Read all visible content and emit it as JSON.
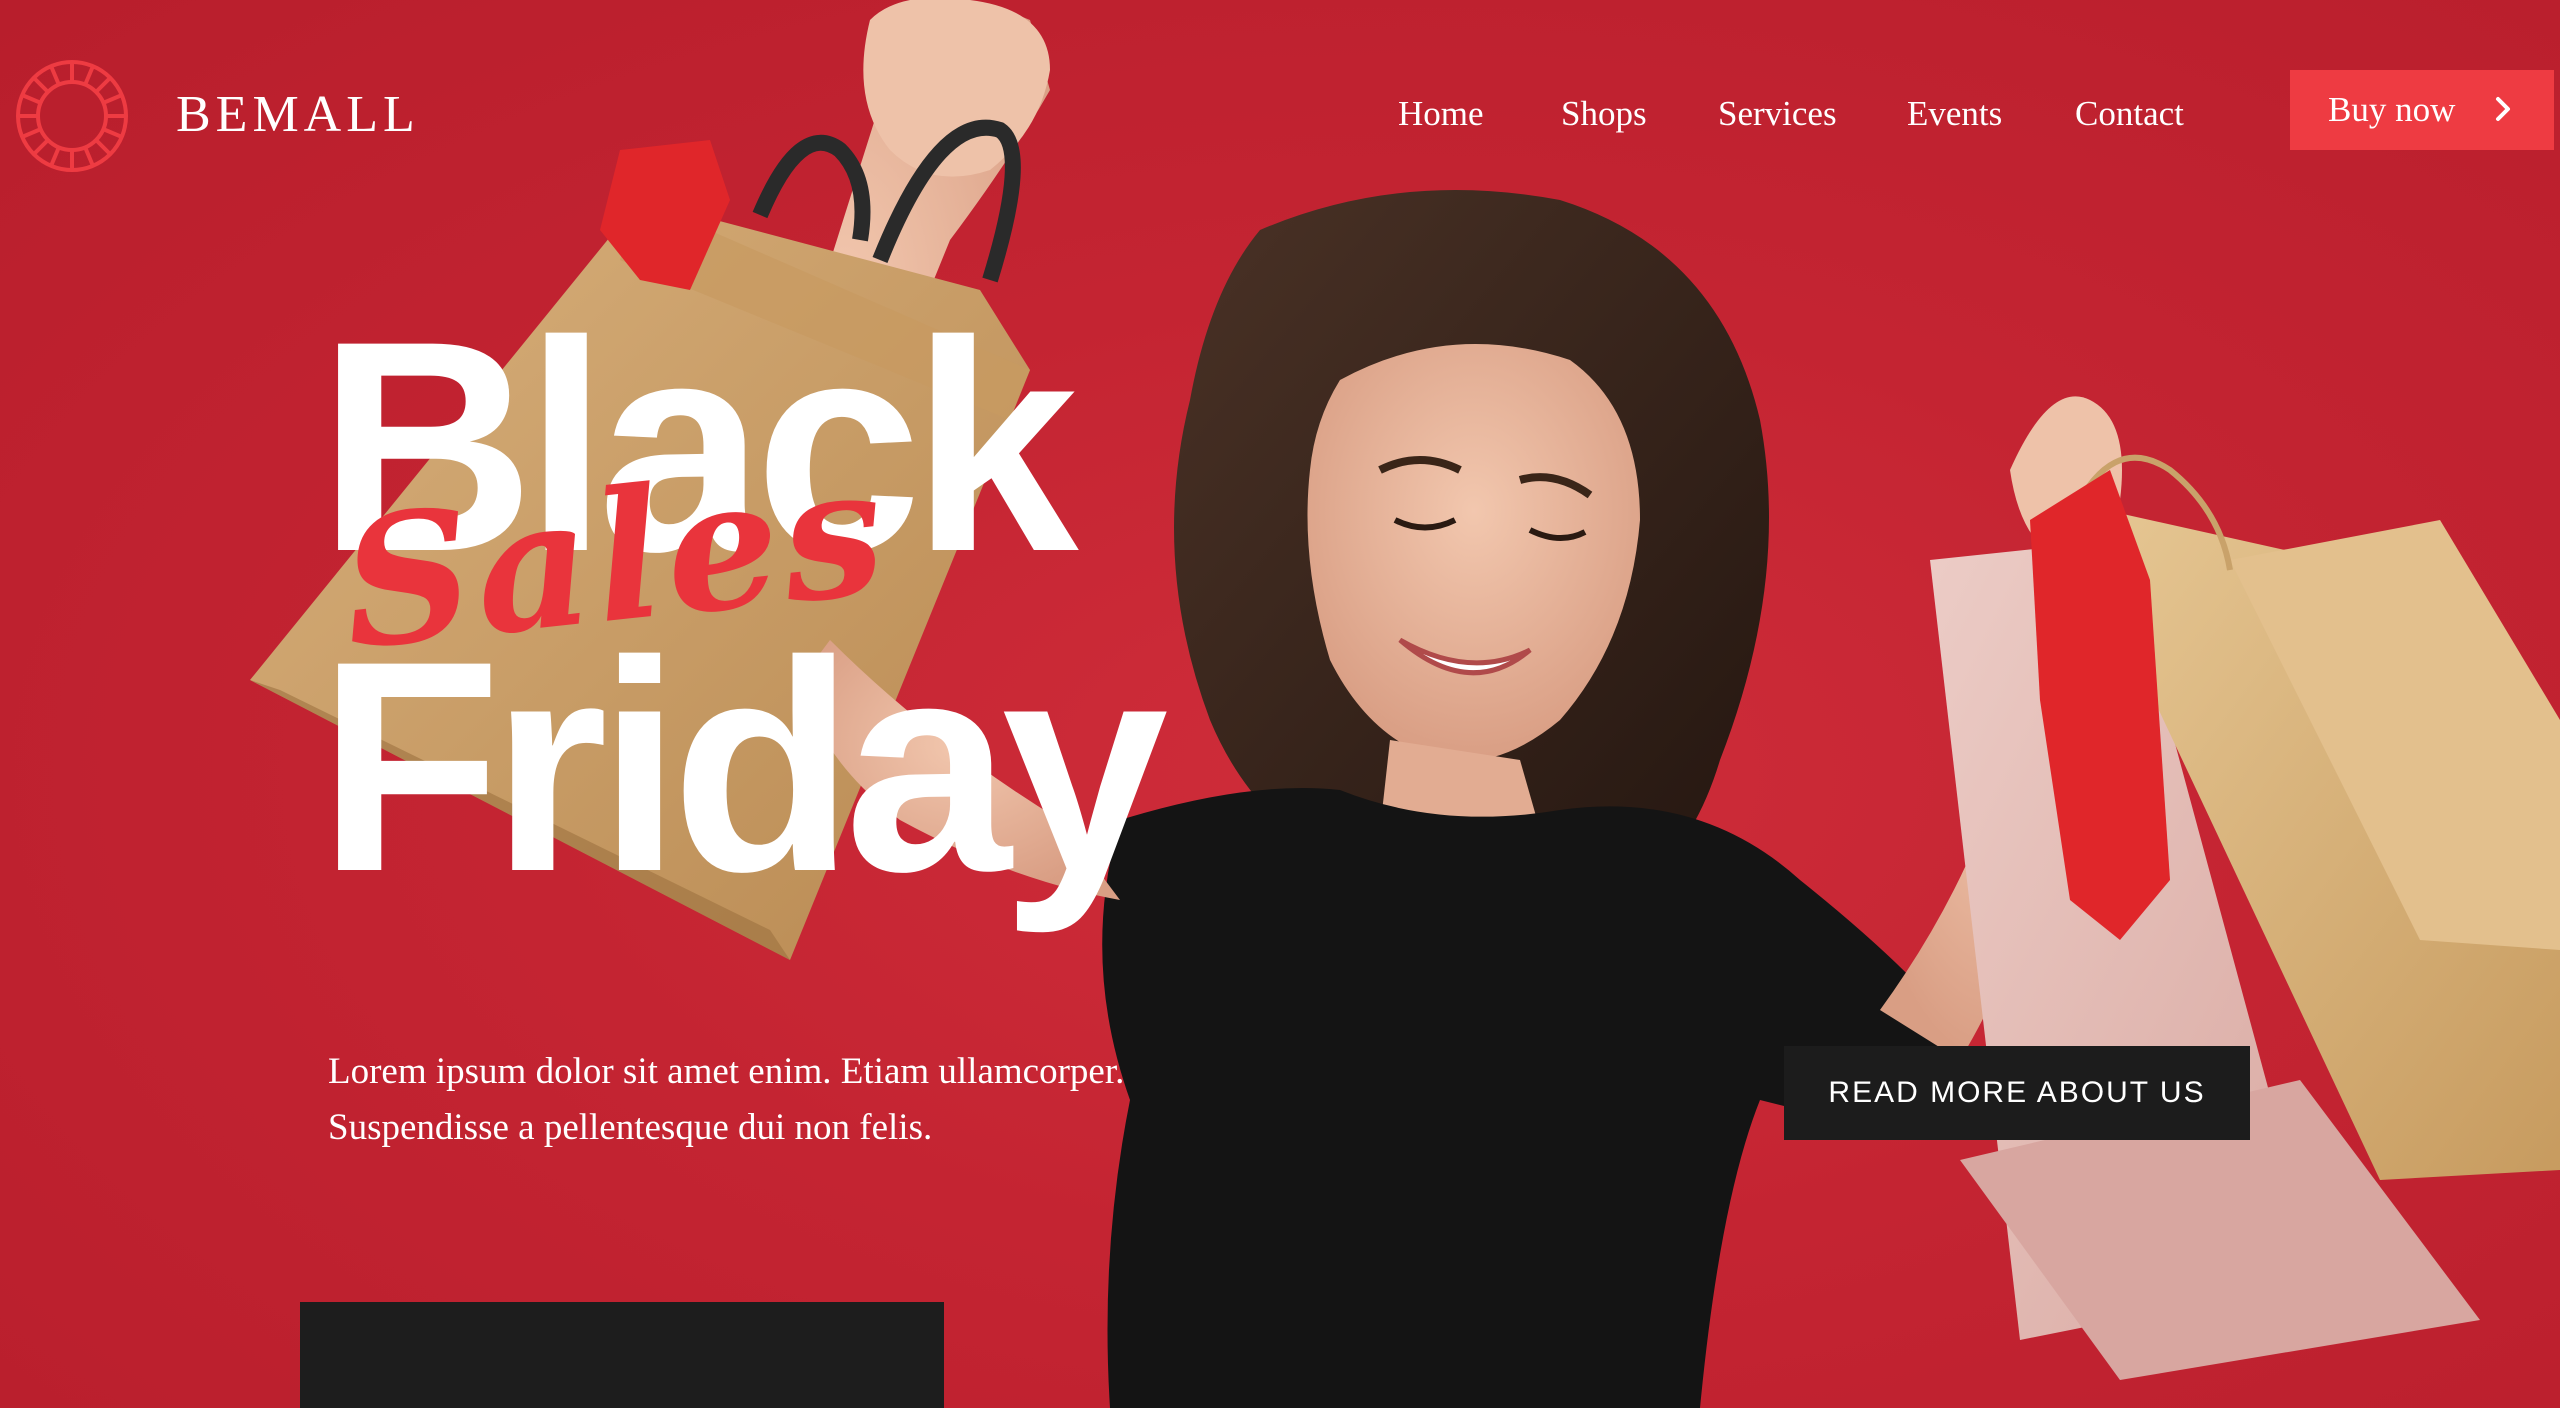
{
  "header": {
    "brand": "BEMALL",
    "nav": [
      {
        "label": "Home"
      },
      {
        "label": "Shops"
      },
      {
        "label": "Services"
      },
      {
        "label": "Events"
      },
      {
        "label": "Contact"
      }
    ],
    "cta_label": "Buy now",
    "cta_icon": "chevron-right-icon",
    "logo_icon": "sun-ring-logo-icon"
  },
  "hero": {
    "headline_line1": "Black",
    "headline_script": "Sales",
    "headline_line2": "Friday",
    "description_line1": "Lorem ipsum dolor sit amet enim. Etiam ullamcorper.",
    "description_line2": "Suspendisse a pellentesque dui non felis.",
    "read_more_label": "READ MORE ABOUT US"
  },
  "colors": {
    "background": "#c82633",
    "accent": "#ee3b42",
    "script_accent": "#e9343c",
    "dark": "#1c1c1c",
    "text": "#ffffff"
  }
}
